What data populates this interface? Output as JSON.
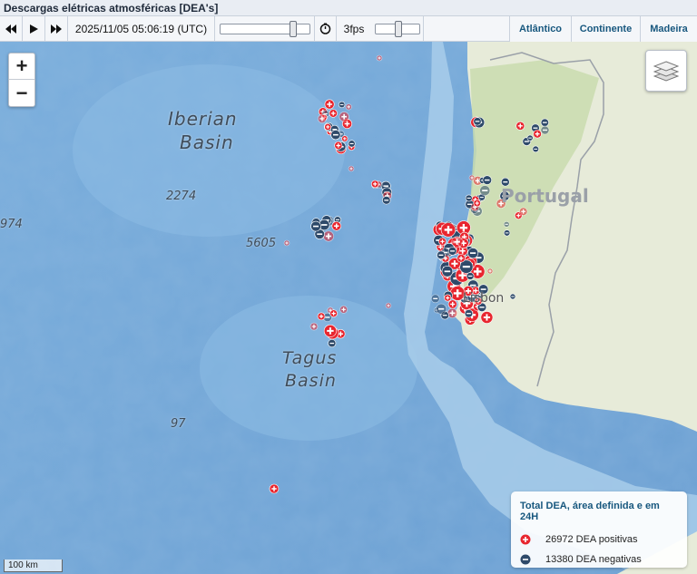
{
  "title": "Descargas elétricas atmosféricas [DEA's]",
  "toolbar": {
    "datetime": "2025/11/05 05:06:19 (UTC)",
    "fps": "3fps",
    "time_slider_value": 0.93,
    "fps_slider_value": 0.42,
    "buttons": [
      "step-back-icon",
      "play-icon",
      "step-forward-icon",
      "timer-icon"
    ]
  },
  "regions": [
    "Atlântico",
    "Continente",
    "Madeira"
  ],
  "zoom": {
    "in": "+",
    "out": "−"
  },
  "legend": {
    "title": "Total DEA, área definida e em 24H",
    "positive": "26972 DEA positivas",
    "negative": "13380 DEA negativas",
    "positive_color": "#e8262f",
    "negative_color": "#2e4a6a"
  },
  "scale": "100 km",
  "map_labels": {
    "iberian_1": "Iberian",
    "iberian_2": "Basin",
    "tagus_1": "Tagus",
    "tagus_2": "Basin",
    "depth_2274": "2274",
    "depth_5605": "5605",
    "depth_974": "974",
    "depth_97": "97",
    "portugal": "Portugal",
    "lisbon": "Lisbon"
  },
  "colors": {
    "ocean": "#7fb1dd",
    "shelf": "#b8d5ec",
    "land": "#e9ecdc",
    "land_green": "#c8dcae"
  }
}
